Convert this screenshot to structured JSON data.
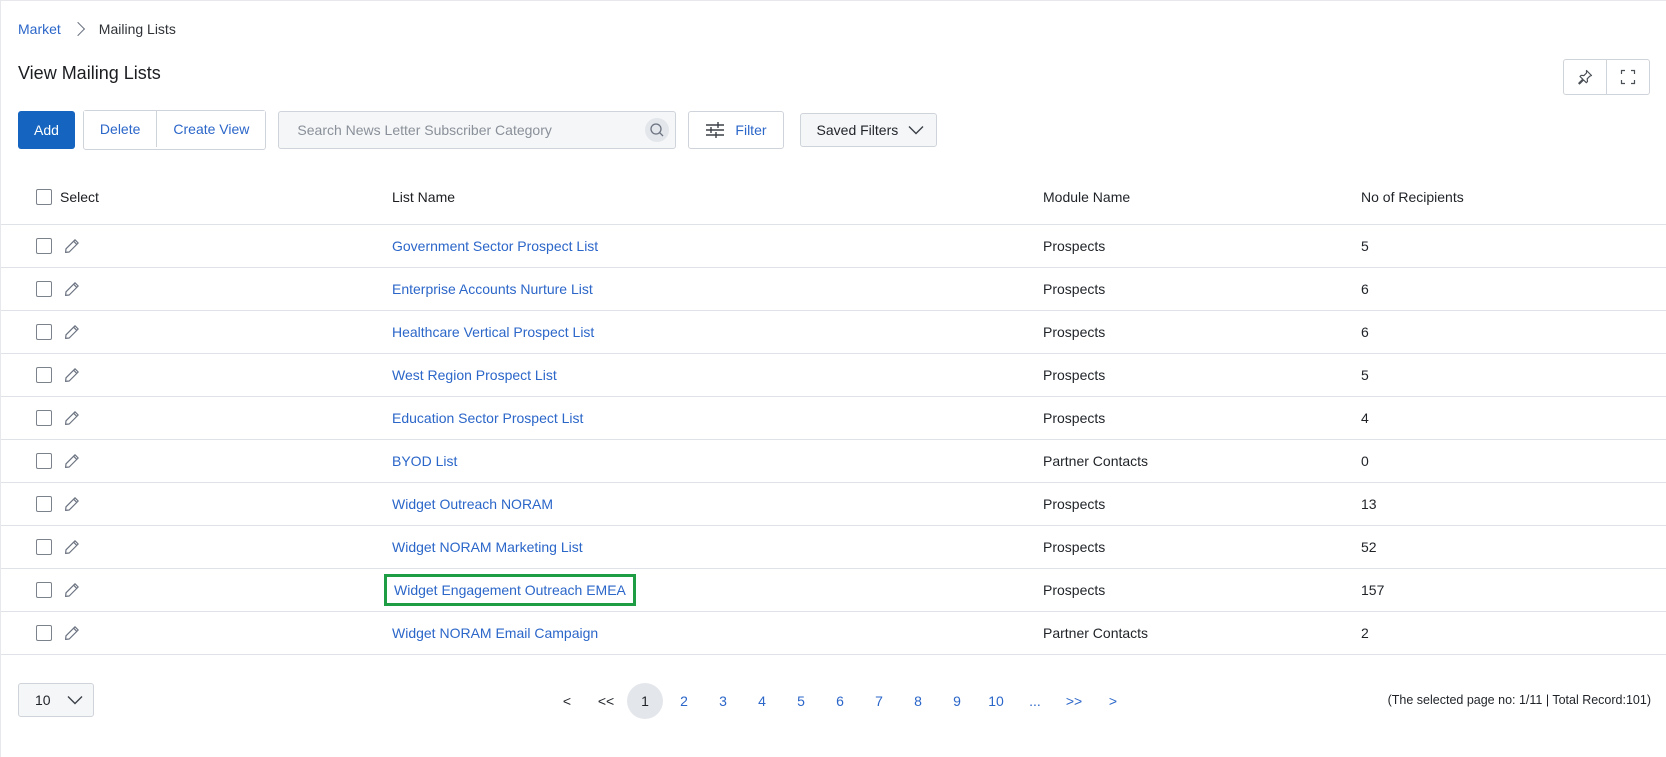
{
  "breadcrumb": {
    "root": "Market",
    "current": "Mailing Lists"
  },
  "page_title": "View Mailing Lists",
  "toolbar": {
    "add_label": "Add",
    "delete_label": "Delete",
    "create_view_label": "Create View",
    "search_placeholder": "Search News Letter Subscriber Category",
    "filter_label": "Filter",
    "saved_filters_label": "Saved Filters"
  },
  "table": {
    "headers": {
      "select": "Select",
      "list_name": "List Name",
      "module_name": "Module Name",
      "recipients": "No of Recipients"
    },
    "rows": [
      {
        "list_name": "Government Sector Prospect List",
        "module": "Prospects",
        "recipients": "5"
      },
      {
        "list_name": "Enterprise Accounts Nurture List",
        "module": "Prospects",
        "recipients": "6"
      },
      {
        "list_name": "Healthcare Vertical Prospect List",
        "module": "Prospects",
        "recipients": "6"
      },
      {
        "list_name": "West Region Prospect List",
        "module": "Prospects",
        "recipients": "5"
      },
      {
        "list_name": "Education Sector Prospect List",
        "module": "Prospects",
        "recipients": "4"
      },
      {
        "list_name": "BYOD List",
        "module": "Partner Contacts",
        "recipients": "0"
      },
      {
        "list_name": "Widget Outreach NORAM",
        "module": "Prospects",
        "recipients": "13"
      },
      {
        "list_name": "Widget NORAM Marketing List",
        "module": "Prospects",
        "recipients": "52"
      },
      {
        "list_name": "Widget Engagement Outreach EMEA",
        "module": "Prospects",
        "recipients": "157"
      },
      {
        "list_name": "Widget NORAM Email Campaign",
        "module": "Partner Contacts",
        "recipients": "2"
      }
    ]
  },
  "footer": {
    "page_size": "10",
    "pager": {
      "prev": "<",
      "first": "<<",
      "pages": [
        "1",
        "2",
        "3",
        "4",
        "5",
        "6",
        "7",
        "8",
        "9",
        "10"
      ],
      "ellipsis": "...",
      "last": ">>",
      "next": ">",
      "active_page": "1"
    },
    "record_info": "(The selected page no: 1/11 | Total Record:101)"
  },
  "colors": {
    "primary": "#1565c0",
    "link": "#2b66c9",
    "highlight_outline": "#1f9d45"
  }
}
